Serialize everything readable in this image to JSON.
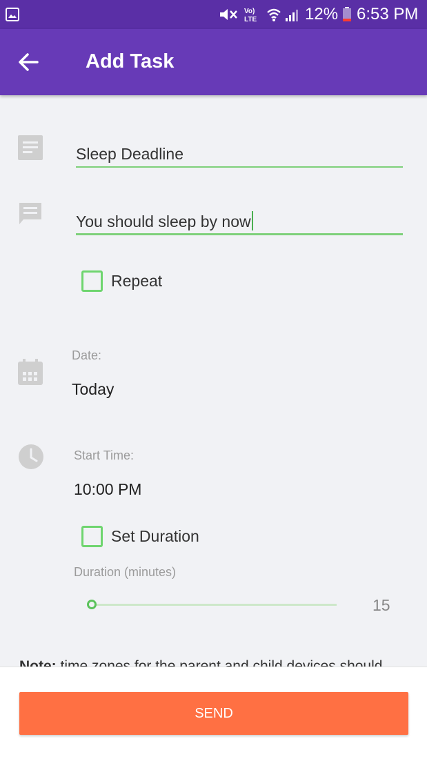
{
  "status_bar": {
    "battery_percent": "12%",
    "time": "6:53 PM",
    "icons": [
      "gallery-icon",
      "mute-icon",
      "volte-icon",
      "wifi-icon",
      "signal-icon",
      "battery-icon"
    ]
  },
  "app_bar": {
    "title": "Add Task",
    "back_icon": "arrow-back-icon"
  },
  "form": {
    "title_field": {
      "value": "Sleep Deadline",
      "icon": "subject-icon"
    },
    "message_field": {
      "value": "You should sleep by now",
      "icon": "comment-icon"
    },
    "repeat": {
      "label": "Repeat",
      "checked": false
    },
    "date": {
      "label": "Date:",
      "value": "Today",
      "icon": "calendar-icon"
    },
    "start_time": {
      "label": "Start Time:",
      "value": "10:00 PM",
      "icon": "clock-icon"
    },
    "set_duration": {
      "label": "Set Duration",
      "checked": false
    },
    "duration": {
      "label": "Duration (minutes)",
      "value": "15",
      "fraction": 0.0
    }
  },
  "note": {
    "bold": "Note:",
    "text": " time zones for the parent and child devices should"
  },
  "send_button": {
    "label": "SEND"
  },
  "colors": {
    "status_bar": "#5a2fa6",
    "app_bar": "#673ab7",
    "accent_green": "#6fd56f",
    "send": "#ff7043",
    "background": "#f1f2f5"
  }
}
